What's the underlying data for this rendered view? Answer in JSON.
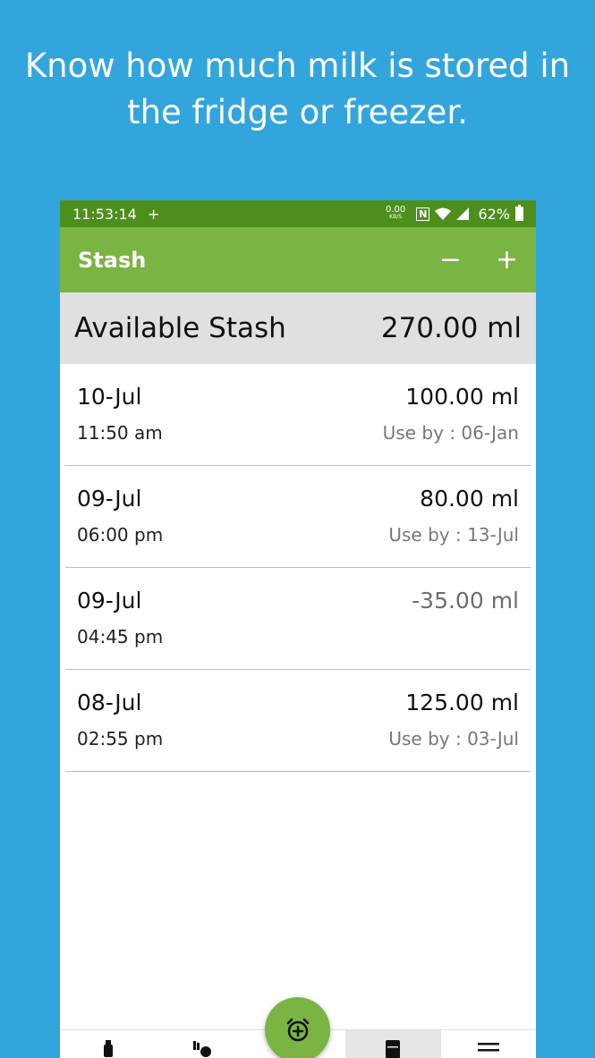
{
  "promo": {
    "line1": "Know how much milk is stored in",
    "line2": "the fridge or freezer."
  },
  "status_bar": {
    "time": "11:53:14",
    "plus": "+",
    "net_speed": "0.00",
    "net_unit": "KB/S",
    "nfc": "N",
    "battery": "62%"
  },
  "app_bar": {
    "title": "Stash",
    "minus_label": "−",
    "plus_label": "+"
  },
  "summary": {
    "label": "Available Stash",
    "value": "270.00 ml"
  },
  "entries": [
    {
      "date": "10-Jul",
      "time": "11:50 am",
      "amount": "100.00 ml",
      "use_by": "Use by : 06-Jan"
    },
    {
      "date": "09-Jul",
      "time": "06:00 pm",
      "amount": "80.00 ml",
      "use_by": "Use by : 13-Jul"
    },
    {
      "date": "09-Jul",
      "time": "04:45 pm",
      "amount": "-35.00 ml",
      "use_by": ""
    },
    {
      "date": "08-Jul",
      "time": "02:55 pm",
      "amount": "125.00 ml",
      "use_by": "Use by : 03-Jul"
    }
  ],
  "bottom_nav": {
    "items": [
      "bottle-icon",
      "pump-icon",
      "alarm-add-icon",
      "fridge-icon",
      "menu-icon"
    ],
    "active": "fridge-icon"
  },
  "colors": {
    "background": "#33a5dd",
    "status_bar": "#4d8f1c",
    "app_bar": "#7ab443",
    "summary_bg": "#e0e0e0"
  }
}
